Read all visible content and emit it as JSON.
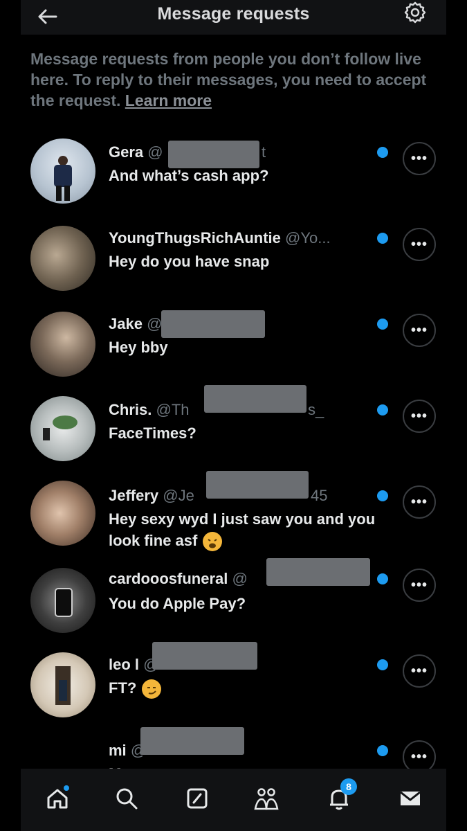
{
  "header": {
    "title": "Message requests",
    "back_icon": "arrow-left-icon",
    "settings_icon": "gear-icon"
  },
  "notice": {
    "text": "Message requests from people you don’t follow live here. To reply to their messages, you need to accept the request.",
    "link": "Learn more"
  },
  "requests": [
    {
      "name": "Gera",
      "handle_start": "@",
      "handle_end": "t",
      "message": "And what’s cash app?",
      "unread": true
    },
    {
      "name": "YoungThugsRichAuntie",
      "handle_start": "@Yo...",
      "handle_end": "",
      "message": "Hey do you have snap",
      "unread": true
    },
    {
      "name": "Jake",
      "handle_start": "@",
      "handle_end": "",
      "message": "Hey bby",
      "unread": true
    },
    {
      "name": "Chris.",
      "handle_start": "@Th",
      "handle_end": "s_",
      "message": "FaceTimes?",
      "unread": true
    },
    {
      "name": "Jeffery",
      "handle_start": "@Je",
      "handle_end": "45",
      "message": "Hey sexy wyd I just saw you and you look fine asf",
      "unread": true
    },
    {
      "name": "cardooosfuneral",
      "handle_start": "@",
      "handle_end": "",
      "message": "You do Apple Pay?",
      "unread": true
    },
    {
      "name": "leo l",
      "handle_start": "@",
      "handle_end": "",
      "message": "FT?",
      "unread": true
    },
    {
      "name": "mi",
      "handle_start": "@",
      "handle_end": "",
      "message": "M......",
      "unread": true
    }
  ],
  "more_label": "•••",
  "bottom_nav": {
    "items": [
      "home-icon",
      "search-icon",
      "compose-icon",
      "communities-icon",
      "notifications-icon",
      "messages-icon"
    ],
    "notification_count": "8"
  },
  "colors": {
    "accent": "#1d9bf0",
    "background": "#000000",
    "muted_text": "#6e767d"
  }
}
